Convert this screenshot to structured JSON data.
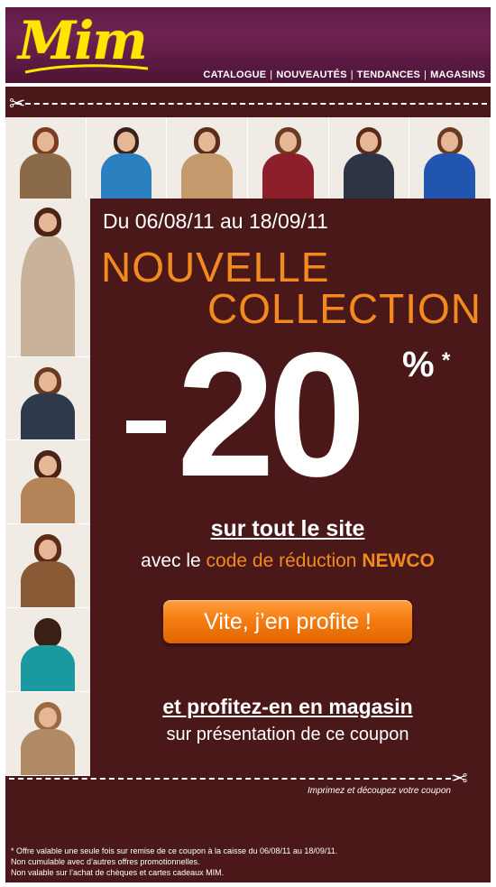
{
  "header": {
    "logo_text": "Mim",
    "brand_color": "#ffe600",
    "nav": [
      {
        "label": "CATALOGUE"
      },
      {
        "label": "NOUVEAUTÉS"
      },
      {
        "label": "TENDANCES"
      },
      {
        "label": "MAGASINS"
      }
    ],
    "nav_separator": "|"
  },
  "coupon": {
    "scissors_icon": "✂",
    "dates": "Du 06/08/11 au 18/09/11",
    "title_line1": "NOUVELLE",
    "title_line2": "COLLECTION",
    "discount_number": "20",
    "discount_percent": "%",
    "discount_star": "*",
    "sitewide": "sur tout le site",
    "code_prefix": "avec le ",
    "code_label": "code de réduction ",
    "code_value": "NEWCO",
    "cta_label": "Vite, j’en profite !",
    "store_title": "et profitez-en en magasin",
    "store_sub": "sur présentation de ce coupon",
    "print_note": "Imprimez et découpez votre coupon",
    "accent_color": "#f28a1f",
    "background_color": "#4a1818"
  },
  "photos": {
    "top_strip": [
      {
        "name": "model-leopard-coat"
      },
      {
        "name": "model-blue-top"
      },
      {
        "name": "model-beige-coat"
      },
      {
        "name": "model-varsity-jacket"
      },
      {
        "name": "model-navy-cardigan"
      },
      {
        "name": "model-blue-puffer"
      }
    ],
    "left_column": [
      {
        "name": "model-trench-scarf"
      },
      {
        "name": "model-cardigan-sitting"
      },
      {
        "name": "model-camel-coat-crouching"
      },
      {
        "name": "model-brown-jacket"
      },
      {
        "name": "model-teal-back"
      },
      {
        "name": "model-knit-hat"
      }
    ]
  },
  "footer": {
    "disclaimer": [
      "* Offre valable une seule fois sur remise de ce coupon à la caisse du 06/08/11 au 18/09/11.",
      "Non cumulable avec d’autres offres promotionnelles.",
      "Non valable sur l’achat de chèques et cartes cadeaux MIM."
    ]
  }
}
